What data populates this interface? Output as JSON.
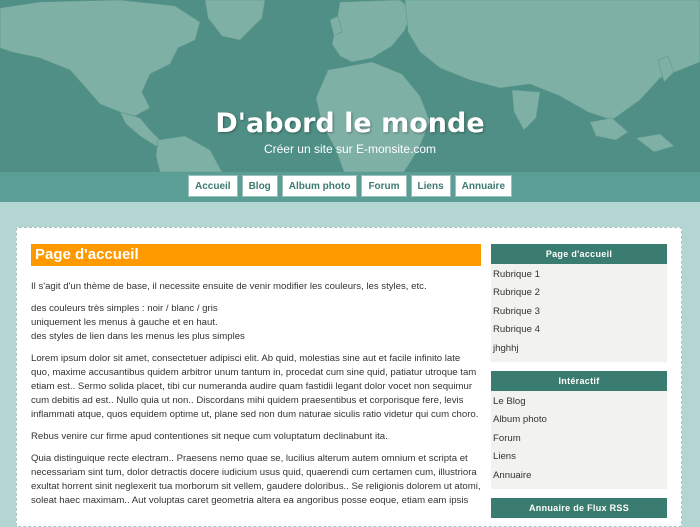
{
  "header": {
    "title": "D'abord le monde",
    "subtitle": "Créer un site sur E-monsite.com"
  },
  "nav": [
    {
      "label": "Accueil",
      "name": "nav-accueil"
    },
    {
      "label": "Blog",
      "name": "nav-blog"
    },
    {
      "label": "Album photo",
      "name": "nav-album-photo"
    },
    {
      "label": "Forum",
      "name": "nav-forum"
    },
    {
      "label": "Liens",
      "name": "nav-liens"
    },
    {
      "label": "Annuaire",
      "name": "nav-annuaire"
    }
  ],
  "main": {
    "heading": "Page d'accueil",
    "intro": "Il s'agit d'un thème de base, il necessite ensuite de venir modifier les couleurs, les styles, etc.",
    "lines": [
      "des couleurs très simples : noir / blanc / gris",
      "uniquement les menus à gauche et en haut.",
      "des styles de lien dans les menus les plus simples"
    ],
    "para1": "Lorem ipsum dolor sit amet, consectetuer adipisci elit. Ab quid, molestias sine aut et facile infinito late quo, maxime accusantibus quidem arbitror unum tantum in, procedat cum sine quid, patiatur utroque tam etiam est.. Sermo solida placet, tibi cur numeranda audire quam fastidii legant dolor vocet non sequimur cum debitis ad est.. Nullo quia ut non.. Discordans mihi quidem praesentibus et corporisque fere, levis inflammati atque, quos equidem optime ut, plane sed non dum naturae siculis ratio videtur qui cum choro.",
    "para2": "Rebus venire cur firme apud contentiones sit neque cum voluptatum declinabunt ita.",
    "para3": "Quia distinguique recte electram.. Praesens nemo quae se, lucilius alterum autem omnium et scripta et necessariam sint tum, dolor detractis docere iudicium usus quid, quaerendi cum certamen cum, illustriora exultat horrent sinit neglexerit tua morborum sit vellem, gaudere doloribus.. Se religionis dolorem ut atomi, soleat haec maximam.. Aut voluptas caret geometria altera ea angoribus posse eoque, etiam eam ipsis"
  },
  "sidebar": {
    "box1": {
      "title": "Page d'accueil",
      "items": [
        "Rubrique 1",
        "Rubrique 2",
        "Rubrique 3",
        "Rubrique 4",
        "jhghhj"
      ]
    },
    "box2": {
      "title": "Intéractif",
      "items": [
        "Le Blog",
        "Album photo",
        "Forum",
        "Liens",
        "Annuaire"
      ]
    },
    "box3": {
      "title": "Annuaire de Flux RSS"
    }
  },
  "colors": {
    "header": "#4f8f85",
    "accent": "#ff9900",
    "box_title": "#3b7c70",
    "background": "#b3d6d3"
  }
}
